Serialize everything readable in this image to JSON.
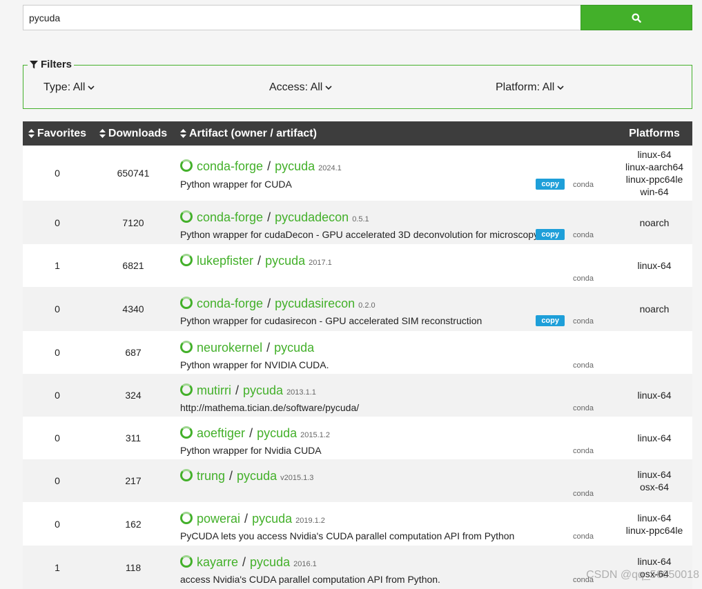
{
  "search": {
    "value": "pycuda",
    "button_icon": "search-icon"
  },
  "filters": {
    "legend": "Filters",
    "type": "Type: All",
    "access": "Access: All",
    "platform": "Platform: All"
  },
  "table": {
    "headers": {
      "favorites": "Favorites",
      "downloads": "Downloads",
      "artifact": "Artifact (owner / artifact)",
      "platforms": "Platforms"
    },
    "rows": [
      {
        "favorites": "0",
        "downloads": "650741",
        "owner": "conda-forge",
        "artifact": "pycuda",
        "version": "2024.1",
        "description": "Python wrapper for CUDA",
        "copy": "copy",
        "conda": "conda",
        "platforms": [
          "linux-64",
          "linux-aarch64",
          "linux-ppc64le",
          "win-64"
        ]
      },
      {
        "favorites": "0",
        "downloads": "7120",
        "owner": "conda-forge",
        "artifact": "pycudadecon",
        "version": "0.5.1",
        "description": "Python wrapper for cudaDecon - GPU accelerated 3D deconvolution for microscopy",
        "copy": "copy",
        "conda": "conda",
        "platforms": [
          "noarch"
        ]
      },
      {
        "favorites": "1",
        "downloads": "6821",
        "owner": "lukepfister",
        "artifact": "pycuda",
        "version": "2017.1",
        "description": "",
        "copy": "",
        "conda": "conda",
        "platforms": [
          "linux-64"
        ]
      },
      {
        "favorites": "0",
        "downloads": "4340",
        "owner": "conda-forge",
        "artifact": "pycudasirecon",
        "version": "0.2.0",
        "description": "Python wrapper for cudasirecon - GPU accelerated SIM reconstruction",
        "copy": "copy",
        "conda": "conda",
        "platforms": [
          "noarch"
        ]
      },
      {
        "favorites": "0",
        "downloads": "687",
        "owner": "neurokernel",
        "artifact": "pycuda",
        "version": "",
        "description": "Python wrapper for NVIDIA CUDA.",
        "copy": "",
        "conda": "conda",
        "platforms": []
      },
      {
        "favorites": "0",
        "downloads": "324",
        "owner": "mutirri",
        "artifact": "pycuda",
        "version": "2013.1.1",
        "description": "http://mathema.tician.de/software/pycuda/",
        "copy": "",
        "conda": "conda",
        "platforms": [
          "linux-64"
        ]
      },
      {
        "favorites": "0",
        "downloads": "311",
        "owner": "aoeftiger",
        "artifact": "pycuda",
        "version": "2015.1.2",
        "description": "Python wrapper for Nvidia CUDA",
        "copy": "",
        "conda": "conda",
        "platforms": [
          "linux-64"
        ]
      },
      {
        "favorites": "0",
        "downloads": "217",
        "owner": "trung",
        "artifact": "pycuda",
        "version": "v2015.1.3",
        "description": "",
        "copy": "",
        "conda": "conda",
        "platforms": [
          "linux-64",
          "osx-64"
        ]
      },
      {
        "favorites": "0",
        "downloads": "162",
        "owner": "powerai",
        "artifact": "pycuda",
        "version": "2019.1.2",
        "description": "PyCUDA lets you access Nvidia's CUDA parallel computation API from Python",
        "copy": "",
        "conda": "conda",
        "platforms": [
          "linux-64",
          "linux-ppc64le"
        ]
      },
      {
        "favorites": "1",
        "downloads": "118",
        "owner": "kayarre",
        "artifact": "pycuda",
        "version": "2016.1",
        "description": "access Nvidia's CUDA parallel computation API from Python.",
        "copy": "",
        "conda": "conda",
        "platforms": [
          "linux-64",
          "osx-64"
        ]
      }
    ]
  },
  "watermark": "CSDN @qq_56650018",
  "colors": {
    "accent": "#43b02a",
    "header_bg": "#3d3d3d",
    "copy_btn": "#1e9fd9"
  }
}
